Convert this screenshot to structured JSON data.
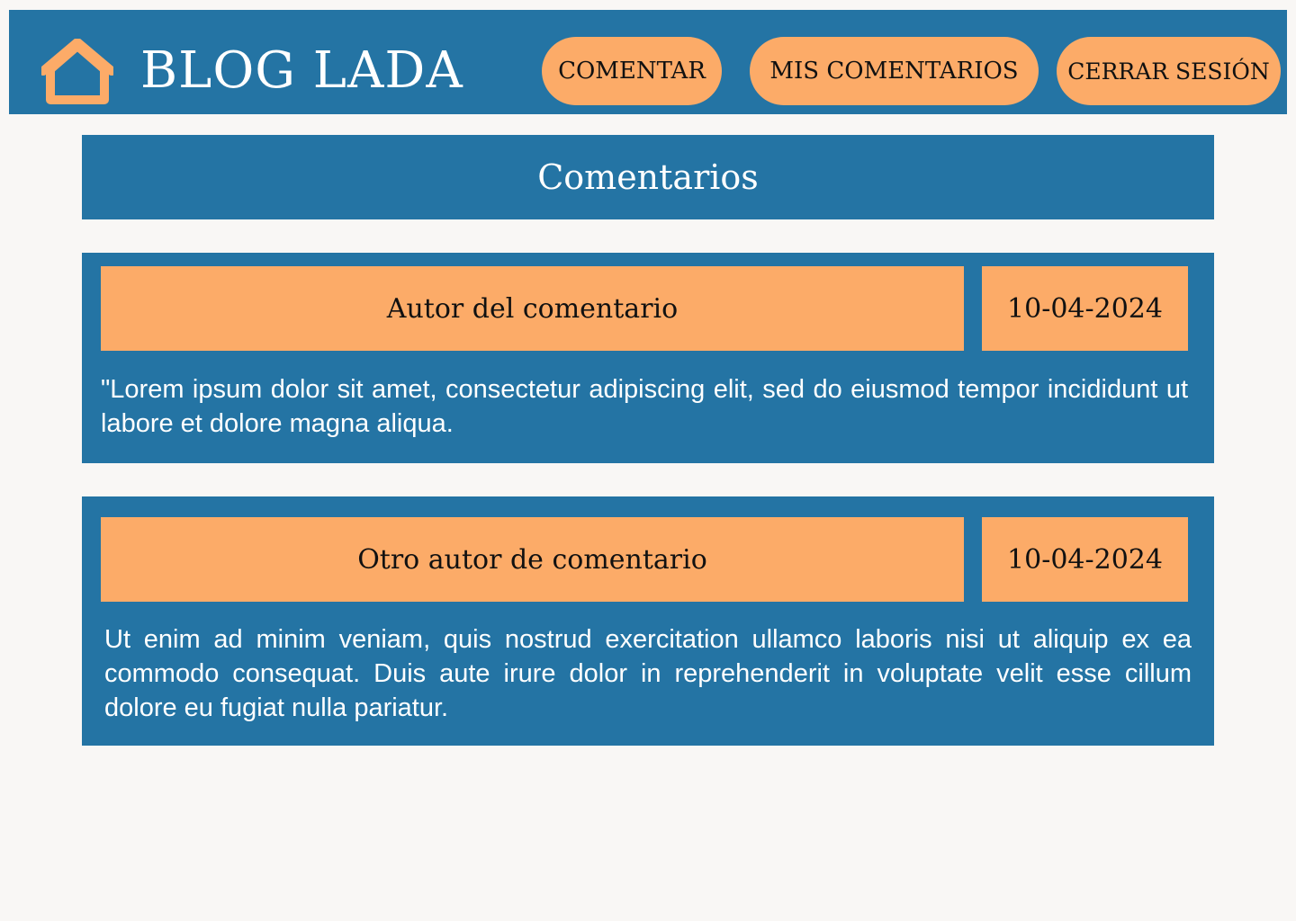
{
  "header": {
    "home_icon": "home-icon",
    "brand": "BLOG LADA",
    "nav": {
      "comentar": "COMENTAR",
      "mis_comentarios": "MIS COMENTARIOS",
      "cerrar_sesion": "CERRAR SESIÓN"
    }
  },
  "main": {
    "title": "Comentarios",
    "comments": [
      {
        "author": "Autor del comentario",
        "date": "10-04-2024",
        "text": "\"Lorem ipsum dolor sit amet, consectetur adipiscing elit, sed do eiusmod tempor incididunt ut labore et dolore magna aliqua."
      },
      {
        "author": "Otro autor de comentario",
        "date": "10-04-2024",
        "text": "Ut enim ad minim veniam, quis nostrud exercitation ullamco laboris nisi ut aliquip ex ea commodo consequat. Duis aute irure dolor in reprehenderit in voluptate velit esse cillum dolore eu fugiat nulla pariatur."
      }
    ]
  },
  "colors": {
    "primary": "#2474a4",
    "accent": "#fcab68",
    "background": "#f9f7f5",
    "text_light": "#ffffff",
    "text_dark": "#111111"
  }
}
